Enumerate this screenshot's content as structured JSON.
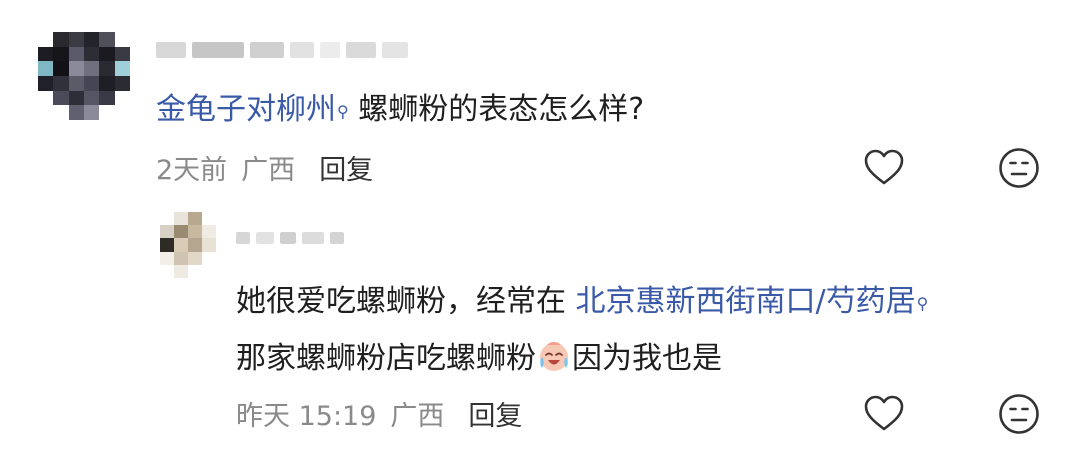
{
  "comment1": {
    "text_link": "金龟子对柳州",
    "text_rest": "螺蛳粉的表态怎么样?",
    "time": "2天前",
    "location": "广西",
    "reply_label": "回复"
  },
  "reply1": {
    "line1_prefix": "她很爱吃螺蛳粉，经常在",
    "line1_link": "北京惠新西街南口/芍药居",
    "line2_before": "那家螺蛳粉店吃螺蛳粉",
    "emoji": "crying-laughing-face-emoji",
    "line2_after": "因为我也是",
    "time": "昨天 15:19",
    "location": "广西",
    "reply_label": "回复"
  },
  "icons": {
    "like": "heart-icon",
    "dislike": "neutral-face-icon",
    "search_marker": "search-icon"
  },
  "colors": {
    "link": "#3a5aa8",
    "meta": "#8a8a8a"
  }
}
